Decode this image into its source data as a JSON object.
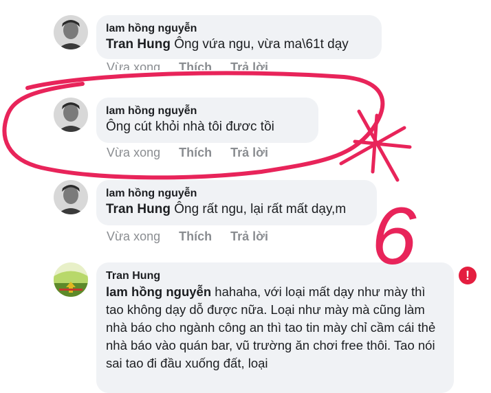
{
  "comments": [
    {
      "author": "lam hồng nguyễn",
      "mention": "Tran Hung",
      "text": " Ông  vứa ngu, vừa ma\\61t dạy",
      "time": "Vừa xong",
      "like": "Thích",
      "reply": "Trả lời"
    },
    {
      "author": "lam hồng nguyễn",
      "mention": "",
      "text": "Ông cút  khỏi nhà tôi  đươc tồi",
      "time": "Vừa xong",
      "like": "Thích",
      "reply": "Trả lời"
    },
    {
      "author": "lam hồng nguyễn",
      "mention": "Tran Hung",
      "text": " Ông  rất ngu, lại rất mất dạy,m",
      "time": "Vừa xong",
      "like": "Thích",
      "reply": "Trả lời"
    },
    {
      "author": "Tran Hung",
      "mention": "lam hồng nguyễn",
      "text": " hahaha, với loại mất dạy như mày thì tao không dạy dỗ được nữa. Loại như mày mà cũng làm nhà báo cho ngành công an thì tao tin mày chỉ cầm cái thẻ nhà báo vào quán bar, vũ trường ăn chơi free thôi. Tao nói sai tao đi đầu xuống đất, loại"
    }
  ],
  "annotation": {
    "number": "6",
    "color": "#e8245a"
  },
  "error_badge": "!",
  "colors": {
    "bubble": "#f0f2f5",
    "meta": "#8a8d91",
    "error": "#e41e3f"
  }
}
